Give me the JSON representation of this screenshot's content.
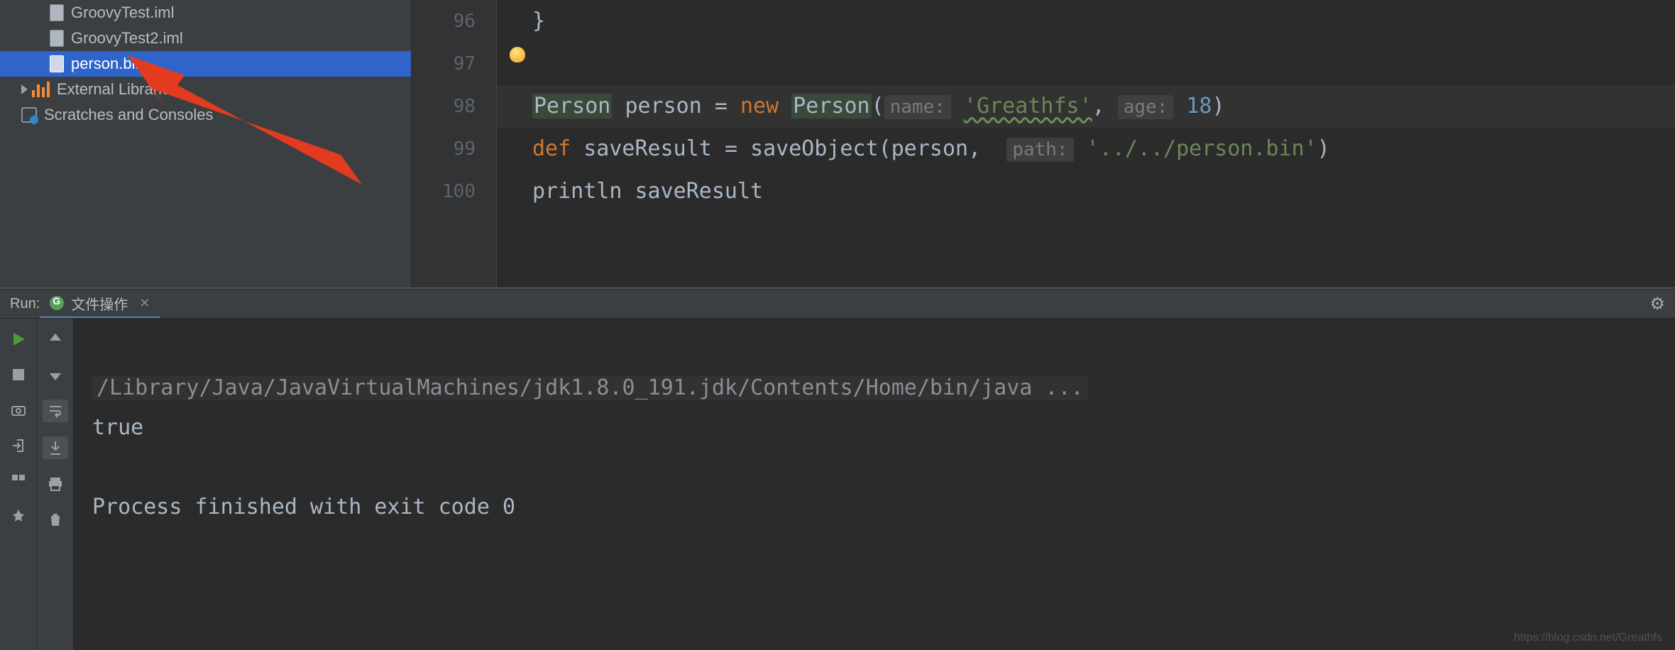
{
  "sidebar": {
    "items": [
      {
        "label": "GroovyTest.iml",
        "type": "file",
        "indent": 0
      },
      {
        "label": "GroovyTest2.iml",
        "type": "file",
        "indent": 0
      },
      {
        "label": "person.bin",
        "type": "file",
        "indent": 0,
        "selected": true
      },
      {
        "label": "External Libraries",
        "type": "libs",
        "indent": 1,
        "expandable": true
      },
      {
        "label": "Scratches and Consoles",
        "type": "scratch",
        "indent": 1
      }
    ]
  },
  "editor": {
    "line_numbers": [
      "96",
      "97",
      "98",
      "99",
      "100"
    ],
    "lines": {
      "l96": "}",
      "l97": "",
      "l98": {
        "cls1": "Person",
        "var": "person",
        "eq": "=",
        "new_kw": "new",
        "cls2": "Person",
        "open": "(",
        "name_hint": "name:",
        "name_val": "'Greathfs'",
        "comma": ",",
        "age_hint": "age:",
        "age_val": "18",
        "close": ")"
      },
      "l99": {
        "def_kw": "def",
        "var": "saveResult",
        "eq": "=",
        "fn": "saveObject",
        "open": "(",
        "arg1": "person",
        "comma": ",",
        "path_hint": "path:",
        "path_val": "'../../person.bin'",
        "close": ")"
      },
      "l100": {
        "fn": "println",
        "arg": "saveResult"
      }
    }
  },
  "run": {
    "label": "Run:",
    "tab_title": "文件操作",
    "gear_icon": "⚙"
  },
  "console": {
    "cmd": "/Library/Java/JavaVirtualMachines/jdk1.8.0_191.jdk/Contents/Home/bin/java ...",
    "out1": "true",
    "blank": "",
    "exit": "Process finished with exit code 0"
  },
  "watermark": "https://blog.csdn.net/Greathfs"
}
